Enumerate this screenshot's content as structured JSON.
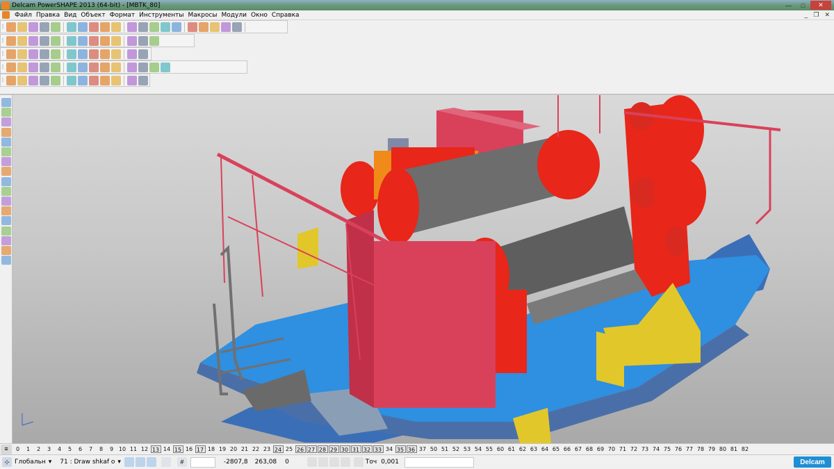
{
  "window": {
    "title": "Delcam PowerSHAPE 2013 (64-bit) - [MBTK_80]",
    "minimize_glyph": "—",
    "maximize_glyph": "□",
    "close_glyph": "✕"
  },
  "menu": {
    "items": [
      "Файл",
      "Правка",
      "Вид",
      "Объект",
      "Формат",
      "Инструменты",
      "Макросы",
      "Модули",
      "Окно",
      "Справка"
    ],
    "mdi_minimize": "_",
    "mdi_restore": "❐",
    "mdi_close": "✕"
  },
  "toolbars": {
    "row1": [
      "new-icon",
      "open-icon",
      "save-icon",
      "print-icon",
      "cut-icon",
      "copy-icon",
      "paste-icon",
      "delete-icon",
      "undo-icon",
      "redo-icon",
      "select-icon",
      "line-icon",
      "arc-icon",
      "curve-icon",
      "text-icon",
      "dimension-icon",
      "surface-icon",
      "solid-icon",
      "mesh-icon",
      "assembly-icon"
    ],
    "row2": [
      "view-top-icon",
      "view-front-icon",
      "view-side-icon",
      "view-iso-icon",
      "zoom-icon",
      "zoom-box-icon",
      "zoom-fit-icon",
      "pan-icon",
      "rotate-icon",
      "shading-icon",
      "wireframe-icon",
      "light-icon",
      "material-icon"
    ],
    "row3": [
      "workplane-icon",
      "level-icon",
      "layer-icon",
      "colour-icon",
      "sphere-icon",
      "cone-icon",
      "block-icon",
      "cylinder-icon",
      "torus-icon",
      "feature-icon",
      "boolean-icon",
      "blend-icon"
    ],
    "row4": [
      "fillet-icon",
      "chamfer-icon",
      "shell-icon",
      "draft-icon",
      "cut-icon",
      "hole-icon",
      "boss-icon",
      "rib-icon",
      "pattern-icon",
      "mirror-icon",
      "scale-icon",
      "move-icon",
      "offset-icon",
      "split-icon"
    ],
    "row5": [
      "solid-tools-icon",
      "extrude-icon",
      "revolve-icon",
      "sweep-icon",
      "loft-icon",
      "box-icon",
      "gear-icon",
      "spring-icon",
      "thread-icon",
      "plate-icon",
      "weld-icon",
      "part-icon"
    ]
  },
  "levels": {
    "items": [
      "0",
      "1",
      "2",
      "3",
      "4",
      "5",
      "6",
      "7",
      "8",
      "9",
      "10",
      "11",
      "12",
      "13",
      "14",
      "15",
      "16",
      "17",
      "18",
      "19",
      "20",
      "21",
      "22",
      "23",
      "24",
      "25",
      "26",
      "27",
      "28",
      "29",
      "30",
      "31",
      "32",
      "33",
      "34",
      "35",
      "36",
      "37",
      "50",
      "51",
      "52",
      "53",
      "54",
      "55",
      "60",
      "61",
      "62",
      "63",
      "64",
      "65",
      "66",
      "67",
      "68",
      "69",
      "70",
      "71",
      "72",
      "73",
      "74",
      "75",
      "76",
      "77",
      "78",
      "79",
      "80",
      "81",
      "82"
    ],
    "active": [
      "13",
      "15",
      "17",
      "24",
      "26",
      "27",
      "28",
      "29",
      "30",
      "31",
      "32",
      "33",
      "35",
      "36"
    ]
  },
  "status": {
    "workplane": "Глобальн",
    "level": "71 : Draw shkaf o",
    "x": "-2807,8",
    "y": "263,08",
    "z": "0",
    "tolerance_label": "Точ",
    "tolerance": "0,001",
    "logo": "Delcam"
  },
  "colors": {
    "red_part": "#e8261a",
    "pink_part": "#d9415a",
    "blue_frame": "#3f78c8",
    "cyan_plate": "#2f8fe0",
    "yellow_bracket": "#e2c72a",
    "steel_drum": "#6d6d6d",
    "orange_motor": "#f08a18"
  }
}
